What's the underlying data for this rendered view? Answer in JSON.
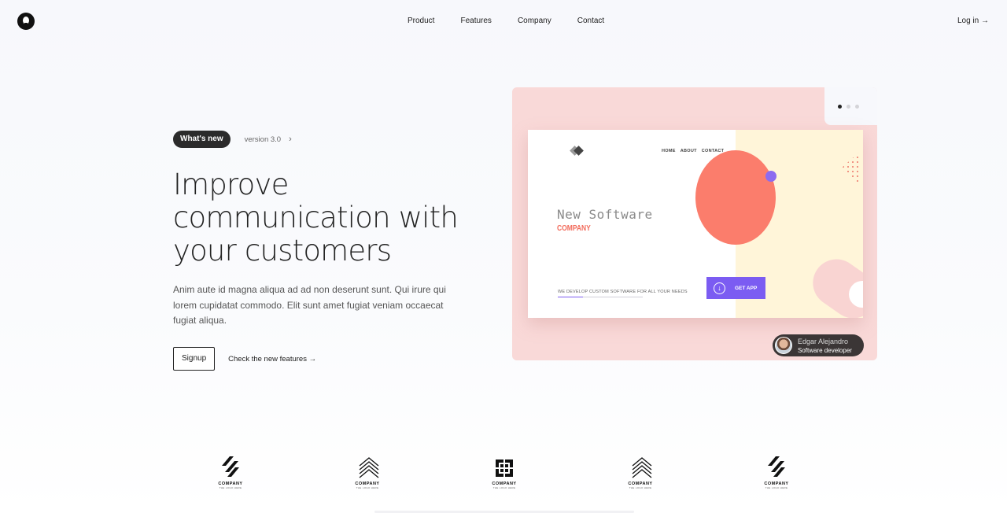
{
  "nav": {
    "items": [
      "Product",
      "Features",
      "Company",
      "Contact"
    ],
    "login": "Log in →"
  },
  "hero": {
    "badge": "What's new",
    "version": "version 3.0",
    "headline_lines": [
      "Improve",
      "communication with",
      "your customers"
    ],
    "description": "Anim aute id magna aliqua ad ad non deserunt sunt. Qui irure qui lorem cupidatat commodo. Elit sunt amet fugiat veniam occaecat fugiat aliqua.",
    "signup": "Signup",
    "features_link": "Check the new features →"
  },
  "showcase": {
    "slides_total": 3,
    "active_slide": 1,
    "mock": {
      "menu": [
        "HOME",
        "ABOUT",
        "CONTACT"
      ],
      "title": "New Software",
      "subtitle": "COMPANY",
      "tagline": "WE DEVELOP CUSTOM SOFTWARE FOR ALL YOUR NEEDS",
      "cta": "GET APP"
    },
    "author": {
      "name": "Edgar Alejandro",
      "role": "Software developer"
    }
  },
  "logos": [
    {
      "name": "COMPANY",
      "tag": "THE LOGO HERE",
      "icon": "slash-stripes"
    },
    {
      "name": "COMPANY",
      "tag": "THE LOGO HERE",
      "icon": "chevron-arrows"
    },
    {
      "name": "COMPANY",
      "tag": "THE LOGO HERE",
      "icon": "square-glyph"
    },
    {
      "name": "COMPANY",
      "tag": "THE LOGO HERE",
      "icon": "chevron-arrows"
    },
    {
      "name": "COMPANY",
      "tag": "THE LOGO HERE",
      "icon": "slash-stripes"
    }
  ]
}
